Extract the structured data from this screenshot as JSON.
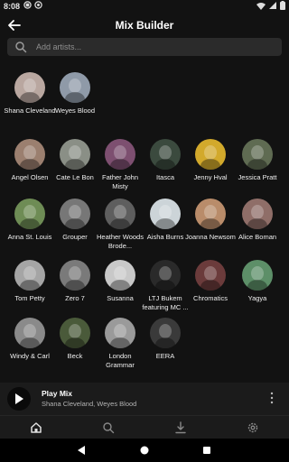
{
  "status_bar": {
    "time": "8:08"
  },
  "header": {
    "title": "Mix Builder"
  },
  "search": {
    "placeholder": "Add artists..."
  },
  "selected_artists": [
    {
      "name": "Shana Cleveland",
      "color": "#b9a7a0"
    },
    {
      "name": "Weyes Blood",
      "color": "#8f9aa8"
    }
  ],
  "suggested_artists": [
    {
      "name": "Angel Olsen",
      "color": "#9b7f6f"
    },
    {
      "name": "Cate Le Bon",
      "color": "#8a8f86"
    },
    {
      "name": "Father John Misty",
      "color": "#7d4f70"
    },
    {
      "name": "Itasca",
      "color": "#3b4a3e"
    },
    {
      "name": "Jenny Hval",
      "color": "#d2a92b"
    },
    {
      "name": "Jessica Pratt",
      "color": "#5f6b52"
    },
    {
      "name": "Anna St. Louis",
      "color": "#6e8c55"
    },
    {
      "name": "Grouper",
      "color": "#777777"
    },
    {
      "name": "Heather Woods Brode...",
      "color": "#5e5e5e"
    },
    {
      "name": "Aisha Burns",
      "color": "#ccd4d8"
    },
    {
      "name": "Joanna Newsom",
      "color": "#b98c6a"
    },
    {
      "name": "Alice Boman",
      "color": "#8f6e68"
    },
    {
      "name": "Tom Petty",
      "color": "#a5a5a5"
    },
    {
      "name": "Zero 7",
      "color": "#7a7a7a"
    },
    {
      "name": "Susanna",
      "color": "#c8c8c8"
    },
    {
      "name": "LTJ Bukem featuring MC ...",
      "color": "#2a2a2a"
    },
    {
      "name": "Chromatics",
      "color": "#6b3b3b"
    },
    {
      "name": "Yagya",
      "color": "#5d8f68"
    },
    {
      "name": "Windy & Carl",
      "color": "#8a8a8a"
    },
    {
      "name": "Beck",
      "color": "#4a5a3a"
    },
    {
      "name": "London Grammar",
      "color": "#9a9a9a"
    },
    {
      "name": "EERA",
      "color": "#3a3a3a"
    }
  ],
  "player": {
    "title": "Play Mix",
    "subtitle": "Shana Cleveland, Weyes Blood"
  },
  "bottom_nav": [
    {
      "icon": "home-icon",
      "active": true
    },
    {
      "icon": "search-icon",
      "active": false
    },
    {
      "icon": "download-icon",
      "active": false
    },
    {
      "icon": "settings-icon",
      "active": false
    }
  ]
}
